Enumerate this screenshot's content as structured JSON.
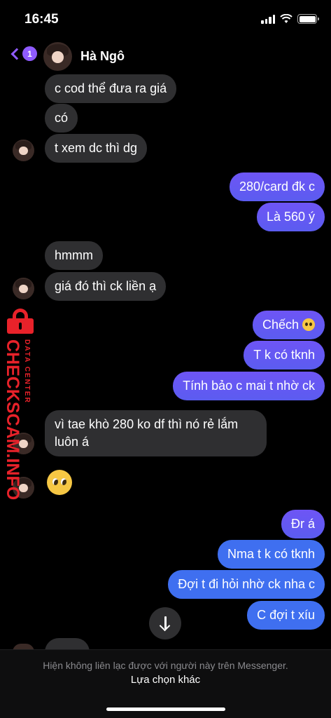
{
  "status": {
    "time": "16:45"
  },
  "header": {
    "back_count": "1",
    "contact_name": "Hà Ngô"
  },
  "messages": [
    {
      "dir": "in",
      "text": "c cod thể đưa ra giá"
    },
    {
      "dir": "in",
      "text": "có"
    },
    {
      "dir": "in",
      "text": "t xem dc thì dg"
    },
    {
      "dir": "out",
      "text": "280/card đk c"
    },
    {
      "dir": "out",
      "text": "Là 560 ý"
    },
    {
      "dir": "in",
      "text": "hmmm"
    },
    {
      "dir": "in",
      "text": "giá đó thì ck liền ạ"
    },
    {
      "dir": "out",
      "text": "Chếch"
    },
    {
      "dir": "out",
      "text": "T k có tknh"
    },
    {
      "dir": "out",
      "text": "Tính bảo c mai t nhờ ck"
    },
    {
      "dir": "in",
      "text_line1": "vì tae khò 280 ko df thì nó rẻ lắm",
      "text_line2": "luôn á"
    },
    {
      "dir": "in",
      "emoji": "pleading-face"
    },
    {
      "dir": "out",
      "text": "Đr á"
    },
    {
      "dir": "out",
      "text": "Nma t k có tknh"
    },
    {
      "dir": "out",
      "text": "Đợi t đi hỏi nhờ ck nha c"
    },
    {
      "dir": "out",
      "text": "C đợi t xíu"
    }
  ],
  "watermark": {
    "main": "CHECKSCAM.INFO",
    "small": "DATA CENTER"
  },
  "footer": {
    "note": "Hiện không liên lạc được với người này trên Messenger.",
    "action": "Lựa chọn khác"
  },
  "icons": {
    "back": "chevron-left-icon",
    "scroll": "arrow-down-icon",
    "emoji": "pleading-face-icon"
  },
  "colors": {
    "accent": "#8f5bff",
    "outgoing": "#6e55f5",
    "outgoing_blue": "#3f6ff0",
    "incoming": "#2f2f31",
    "watermark": "#e8222a"
  }
}
